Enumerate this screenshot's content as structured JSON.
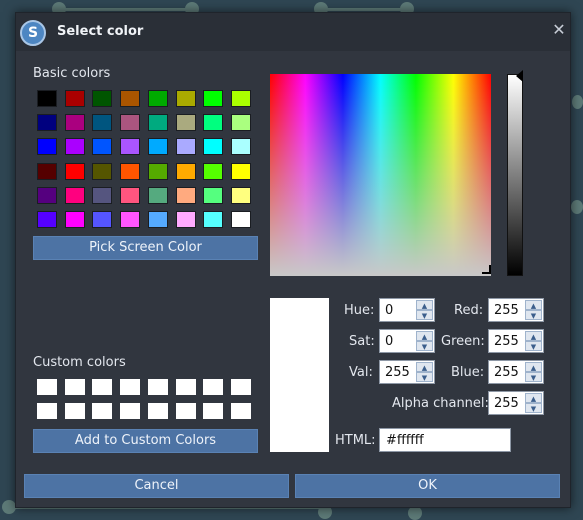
{
  "dialog": {
    "title": "Select color",
    "app_icon": "app-logo-icon",
    "close_icon": "close-icon"
  },
  "basic_colors": {
    "label": "Basic colors",
    "swatches": [
      "#000000",
      "#aa0000",
      "#005500",
      "#aa5500",
      "#00aa00",
      "#aaaa00",
      "#00ff00",
      "#aaff00",
      "#00007f",
      "#aa007f",
      "#00557f",
      "#aa557f",
      "#00aa7f",
      "#aaaa7f",
      "#00ff7f",
      "#aaff7f",
      "#0000ff",
      "#aa00ff",
      "#0055ff",
      "#aa55ff",
      "#00aaff",
      "#aaaaff",
      "#00ffff",
      "#aaffff",
      "#550000",
      "#ff0000",
      "#555500",
      "#ff5500",
      "#55aa00",
      "#ffaa00",
      "#55ff00",
      "#ffff00",
      "#55007f",
      "#ff007f",
      "#55557f",
      "#ff557f",
      "#55aa7f",
      "#ffaa7f",
      "#55ff7f",
      "#ffff7f",
      "#5500ff",
      "#ff00ff",
      "#5555ff",
      "#ff55ff",
      "#55aaff",
      "#ffaaff",
      "#55ffff",
      "#ffffff"
    ]
  },
  "pick_screen_button": "Pick Screen Color",
  "custom_colors": {
    "label": "Custom colors",
    "count": 16
  },
  "add_custom_button": "Add to Custom Colors",
  "fields": {
    "hue": {
      "label": "Hue:",
      "value": "0"
    },
    "sat": {
      "label": "Sat:",
      "value": "0"
    },
    "val": {
      "label": "Val:",
      "value": "255"
    },
    "red": {
      "label": "Red:",
      "value": "255"
    },
    "green": {
      "label": "Green:",
      "value": "255"
    },
    "blue": {
      "label": "Blue:",
      "value": "255"
    },
    "alpha": {
      "label": "Alpha channel:",
      "value": "255"
    },
    "html": {
      "label": "HTML:",
      "value": "#ffffff"
    }
  },
  "buttons": {
    "cancel": "Cancel",
    "ok": "OK"
  },
  "colors": {
    "dialog_bg": "#31363f",
    "accent": "#4d73a4",
    "selected_color": "#ffffff"
  }
}
